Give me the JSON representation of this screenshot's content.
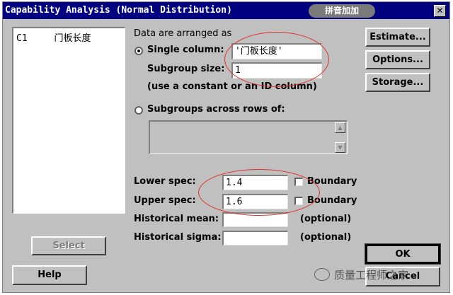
{
  "window": {
    "title": "Capability Analysis (Normal Distribution)",
    "close_glyph": "✕",
    "banner": "拼音加加"
  },
  "variables": {
    "items": [
      {
        "id": "C1",
        "name": "门板长度"
      }
    ]
  },
  "data_arranged": {
    "heading": "Data are arranged as",
    "single_column_label": "Single column:",
    "single_column_selected": true,
    "single_column_value": "'门板长度'",
    "subgroup_size_label": "Subgroup size:",
    "subgroup_size_value": "1",
    "hint": "(use a constant or an ID column)",
    "subgroups_label": "Subgroups across rows of:",
    "subgroups_selected": false
  },
  "specs": {
    "lower_label": "Lower spec:",
    "lower_value": "1.4",
    "upper_label": "Upper spec:",
    "upper_value": "1.6",
    "boundary_label": "Boundary",
    "lower_boundary_checked": false,
    "upper_boundary_checked": false,
    "hist_mean_label": "Historical mean:",
    "hist_mean_value": "",
    "hist_sigma_label": "Historical sigma:",
    "hist_sigma_value": "",
    "optional_label": "(optional)"
  },
  "buttons": {
    "estimate": "Estimate...",
    "options": "Options...",
    "storage": "Storage...",
    "select": "Select",
    "help": "Help",
    "ok": "OK",
    "cancel": "Cancel"
  },
  "watermark": {
    "text": "质量工程师之家",
    "icon": "wechat-icon"
  },
  "colors": {
    "title_bar": "#000080",
    "dialog_bg": "#c0c0c0",
    "annotation": "#e0302a"
  }
}
